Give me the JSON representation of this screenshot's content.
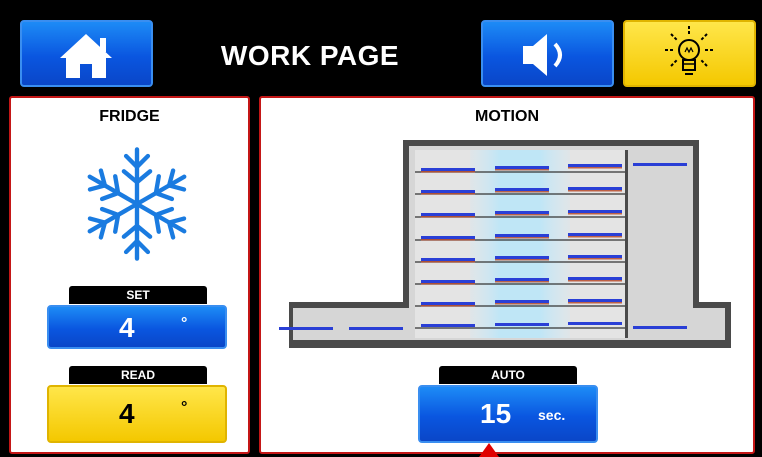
{
  "header": {
    "title": "WORK PAGE",
    "home_icon": "home-icon",
    "sound_icon": "speaker-icon",
    "light_icon": "lightbulb-icon"
  },
  "fridge": {
    "title": "FRIDGE",
    "icon": "snowflake-icon",
    "set_label": "SET",
    "set_value": "4",
    "set_unit": "°",
    "read_label": "READ",
    "read_value": "4",
    "read_unit": "°"
  },
  "motion": {
    "title": "MOTION",
    "auto_label": "AUTO",
    "auto_value": "15",
    "auto_unit": "sec."
  },
  "colors": {
    "accent_blue": "#0a56e0",
    "accent_yellow": "#f4c800",
    "panel_border": "#c41717",
    "indicator": "#e00000"
  }
}
